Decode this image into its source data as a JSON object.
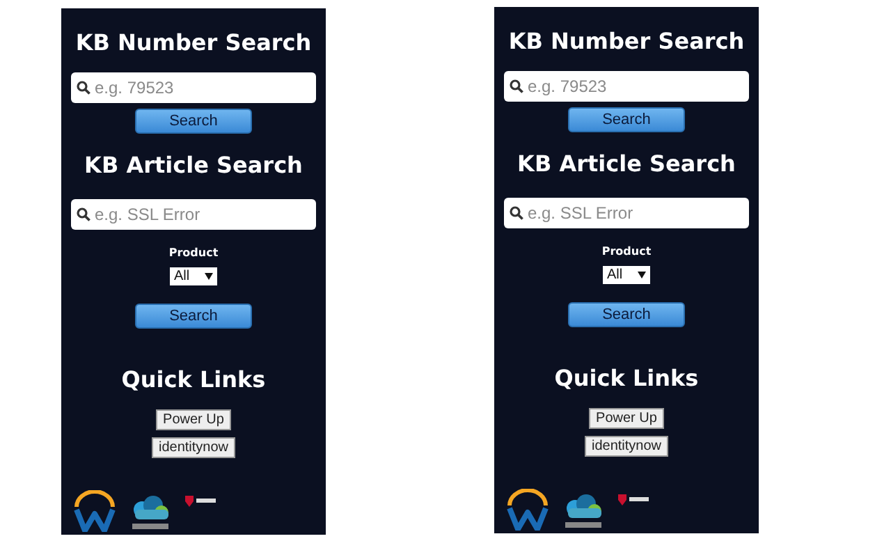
{
  "panels": [
    {
      "number_search": {
        "title": "KB Number Search",
        "placeholder": "e.g. 79523",
        "button": "Search"
      },
      "article_search": {
        "title": "KB Article Search",
        "placeholder": "e.g. SSL Error",
        "product_label": "Product",
        "product_value": "All",
        "button": "Search"
      },
      "quick_links": {
        "title": "Quick Links",
        "links": [
          "Power Up",
          "identitynow"
        ]
      }
    },
    {
      "number_search": {
        "title": "KB Number Search",
        "placeholder": "e.g. 79523",
        "button": "Search"
      },
      "article_search": {
        "title": "KB Article Search",
        "placeholder": "e.g. SSL Error",
        "product_label": "Product",
        "product_value": "All",
        "button": "Search"
      },
      "quick_links": {
        "title": "Quick Links",
        "links": [
          "Power Up",
          "identitynow"
        ]
      }
    }
  ]
}
